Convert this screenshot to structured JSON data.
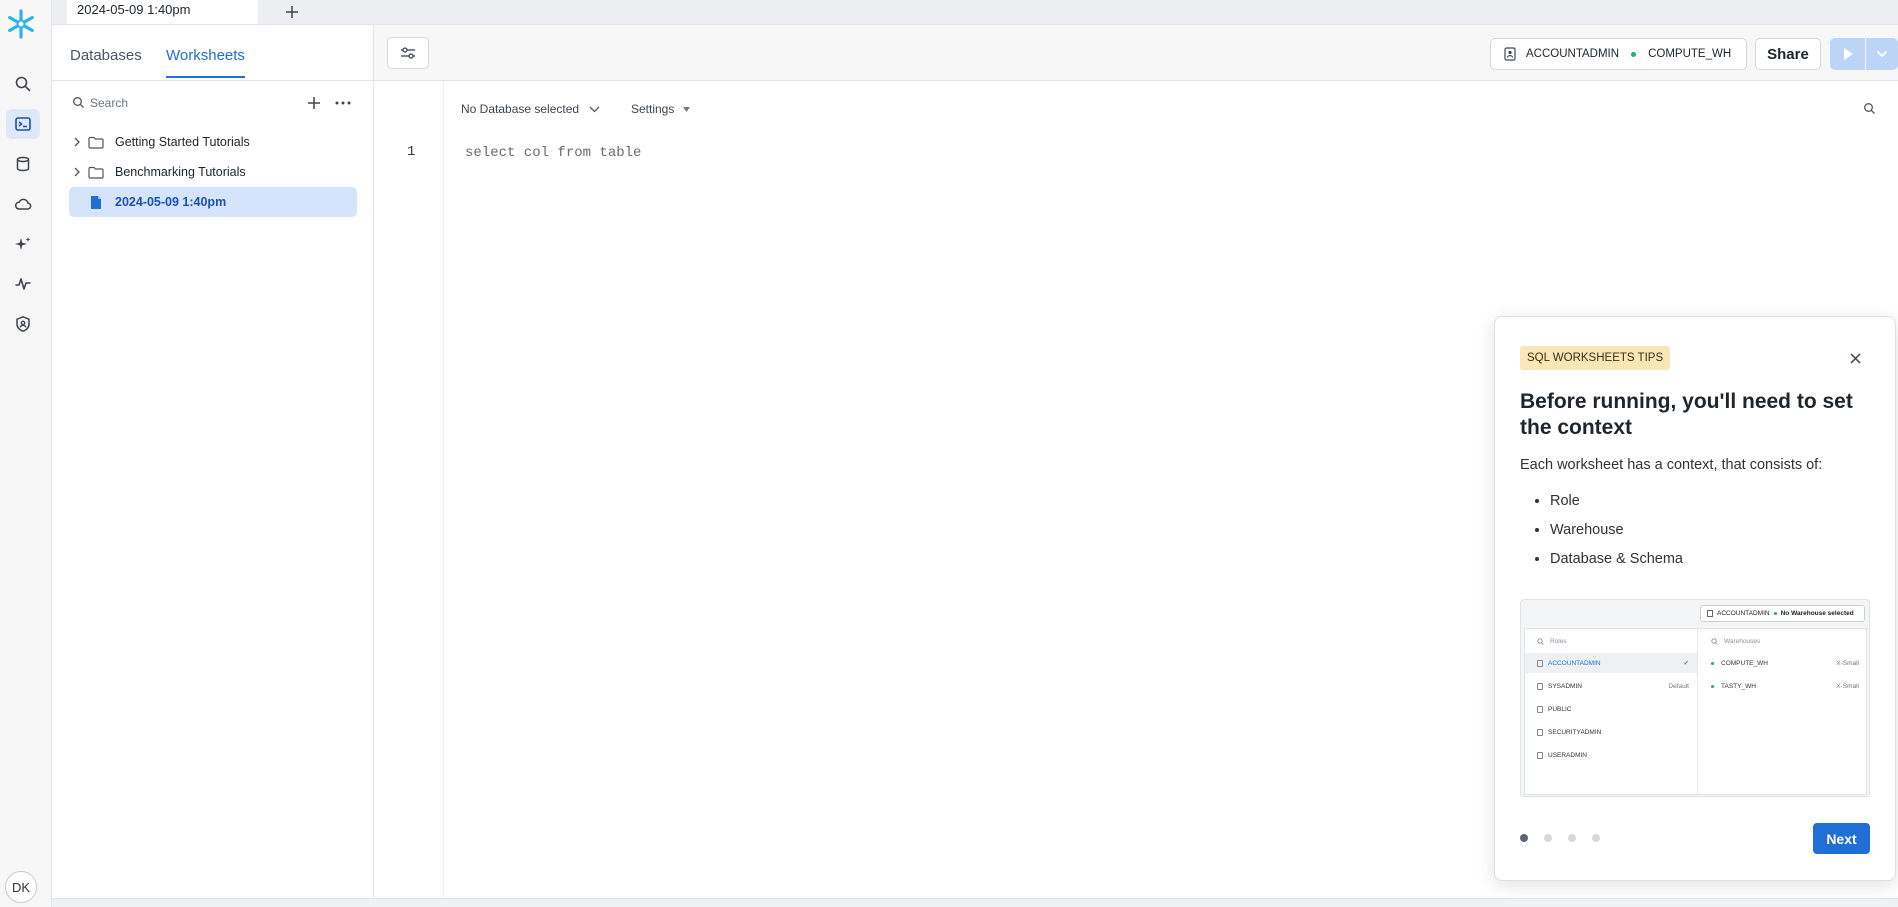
{
  "tab_bar": {
    "active_tab": "2024-05-09 1:40pm"
  },
  "rail": {
    "avatar_initials": "DK"
  },
  "sidebar": {
    "tabs": [
      {
        "label": "Databases"
      },
      {
        "label": "Worksheets"
      }
    ],
    "search_placeholder": "Search",
    "items": [
      {
        "label": "Getting Started Tutorials",
        "type": "folder"
      },
      {
        "label": "Benchmarking Tutorials",
        "type": "folder"
      },
      {
        "label": "2024-05-09 1:40pm",
        "type": "worksheet"
      }
    ]
  },
  "header": {
    "role": "ACCOUNTADMIN",
    "warehouse": "COMPUTE_WH",
    "share_label": "Share"
  },
  "editor": {
    "database_selector": "No Database selected",
    "settings_label": "Settings",
    "lines": [
      {
        "number": "1",
        "code": "select col from table"
      }
    ]
  },
  "tips": {
    "badge": "SQL WORKSHEETS TIPS",
    "title": "Before running, you'll need to set the context",
    "intro": "Each worksheet has a context, that consists of:",
    "bullets": [
      "Role",
      "Warehouse",
      "Database & Schema"
    ],
    "next_label": "Next",
    "preview": {
      "top_role": "ACCOUNTADMIN",
      "top_warehouse": "No Warehouse selected",
      "roles_placeholder": "Roles",
      "warehouses_placeholder": "Warehouses",
      "roles": [
        {
          "name": "ACCOUNTADMIN",
          "meta": "✔"
        },
        {
          "name": "SYSADMIN",
          "meta": "Default"
        },
        {
          "name": "PUBLIC",
          "meta": ""
        },
        {
          "name": "SECURITYADMIN",
          "meta": ""
        },
        {
          "name": "USERADMIN",
          "meta": ""
        }
      ],
      "warehouses": [
        {
          "name": "COMPUTE_WH",
          "size": "X-Small"
        },
        {
          "name": "TASTY_WH",
          "size": "X-Small"
        }
      ]
    }
  },
  "colors": {
    "accent": "#1f6fd6",
    "logo": "#29b5e8",
    "badge_bg": "#fbe6b8",
    "status_green": "#29a96b"
  }
}
